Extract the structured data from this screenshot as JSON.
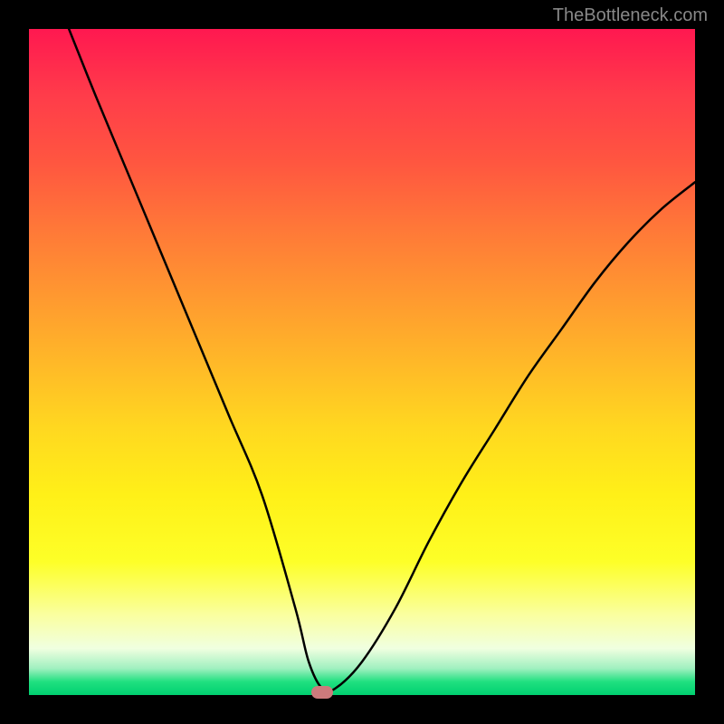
{
  "watermark": "TheBottleneck.com",
  "chart_data": {
    "type": "line",
    "title": "",
    "xlabel": "",
    "ylabel": "",
    "xlim": [
      0,
      100
    ],
    "ylim": [
      0,
      100
    ],
    "background_gradient": {
      "top_color": "#ff1850",
      "bottom_color": "#00d070",
      "note": "red-orange-yellow-green vertical gradient indicating bottleneck severity"
    },
    "series": [
      {
        "name": "bottleneck-curve",
        "x": [
          6,
          10,
          15,
          20,
          25,
          30,
          35,
          40,
          42,
          44,
          46,
          50,
          55,
          60,
          65,
          70,
          75,
          80,
          85,
          90,
          95,
          100
        ],
        "values": [
          100,
          90,
          78,
          66,
          54,
          42,
          30,
          13,
          5,
          1,
          1,
          5,
          13,
          23,
          32,
          40,
          48,
          55,
          62,
          68,
          73,
          77
        ]
      }
    ],
    "marker": {
      "x": 44,
      "y": 0,
      "color": "#cd7a7c"
    }
  }
}
